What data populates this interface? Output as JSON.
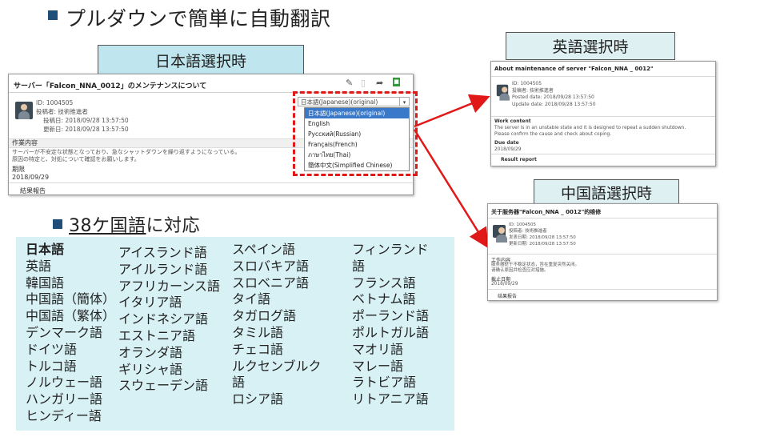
{
  "heading": "プルダウンで簡単に自動翻訳",
  "labels": {
    "ja": "日本語選択時",
    "en": "英語選択時",
    "cn": "中国語選択時"
  },
  "ja_panel": {
    "title": "サーバー「Falcon_NNA_0012」のメンテナンスについて",
    "id": "ID: 1004505",
    "poster": "投稿者: 技術推進者",
    "posted": "投稿日: 2018/09/28 13:57:50",
    "updated": "更新日: 2018/09/28 13:57:50",
    "work_head": "作業内容",
    "work_body1": "サーバーが不安定な状態となっており、急なシャットダウンを繰り返すようになっている。",
    "work_body2": "原因の特定と、対処について確認をお願いします。",
    "due_head": "期限",
    "due_value": "2018/09/29",
    "result_head": "結果報告",
    "dropdown_value": "日本語(Japanese)(original)",
    "dropdown_options": [
      "日本語(Japanese)(original)",
      "English",
      "Русский(Russian)",
      "Français(French)",
      "ภาษาไทย(Thai)",
      "簡体中文(Simplified Chinese)"
    ]
  },
  "en_panel": {
    "title": "About maintenance of server \"Falcon_NNA _ 0012\"",
    "id": "ID: 1004505",
    "poster": "投稿者: 技術推進者",
    "posted": "Posted date: 2018/09/28 13:57:50",
    "updated": "Update date: 2018/09/28 13:57:50",
    "work_head": "Work content",
    "work_body1": "The server is in an unstable state and it is designed to repeat a sudden shutdown.",
    "work_body2": "Please confirm the cause and check about coping.",
    "due_head": "Due date",
    "due_value": "2018/09/29",
    "result_head": "Result report"
  },
  "cn_panel": {
    "title": "关于服务器\"Falcon_NNA _ 0012\"的维修",
    "id": "ID: 1004505",
    "poster": "投稿者: 技術推進者",
    "posted": "发表日期: 2018/09/28 13:57:50",
    "updated": "更新日期: 2018/09/28 13:57:50",
    "work_head": "工作内容",
    "work_body1": "服务器处于不稳定状态，旨在重复突然关闭。",
    "work_body2": "请确认原因并检查应对措施。",
    "due_head": "截止日期",
    "due_value": "2018/09/29",
    "result_head": "结果报告"
  },
  "sub_heading": {
    "underlined": "38ケ国語",
    "rest": "に対応"
  },
  "languages": {
    "col1": [
      "日本語",
      "英語",
      "韓国語",
      "中国語（簡体）",
      "中国語（繁体）",
      "デンマーク語",
      "ドイツ語",
      "トルコ語",
      "ノルウェー語",
      "ハンガリー語",
      "ヒンディー語"
    ],
    "col2": [
      "アイスランド語",
      "アイルランド語",
      "アフリカーンス語",
      "イタリア語",
      "インドネシア語",
      "エストニア語",
      "オランダ語",
      "ギリシャ語",
      "スウェーデン語"
    ],
    "col3": [
      "スペイン語",
      "スロバキア語",
      "スロベニア語",
      "タイ語",
      "タガログ語",
      "タミル語",
      "チェコ語",
      "ルクセンブルク",
      "語",
      "ロシア語"
    ],
    "col4": [
      "フィンランド",
      "語",
      "フランス語",
      "ベトナム語",
      "ポーランド語",
      "ポルトガル語",
      "マオリ語",
      "マレー語",
      "ラトビア語",
      "リトアニア語"
    ]
  },
  "colors": {
    "bullet": "#1f4e79",
    "label_ja": "#bfe6ee",
    "label_other": "#dff0f3",
    "lang_bg": "#d8f1f5",
    "highlight": "#e01818",
    "selected": "#3a78c9"
  }
}
